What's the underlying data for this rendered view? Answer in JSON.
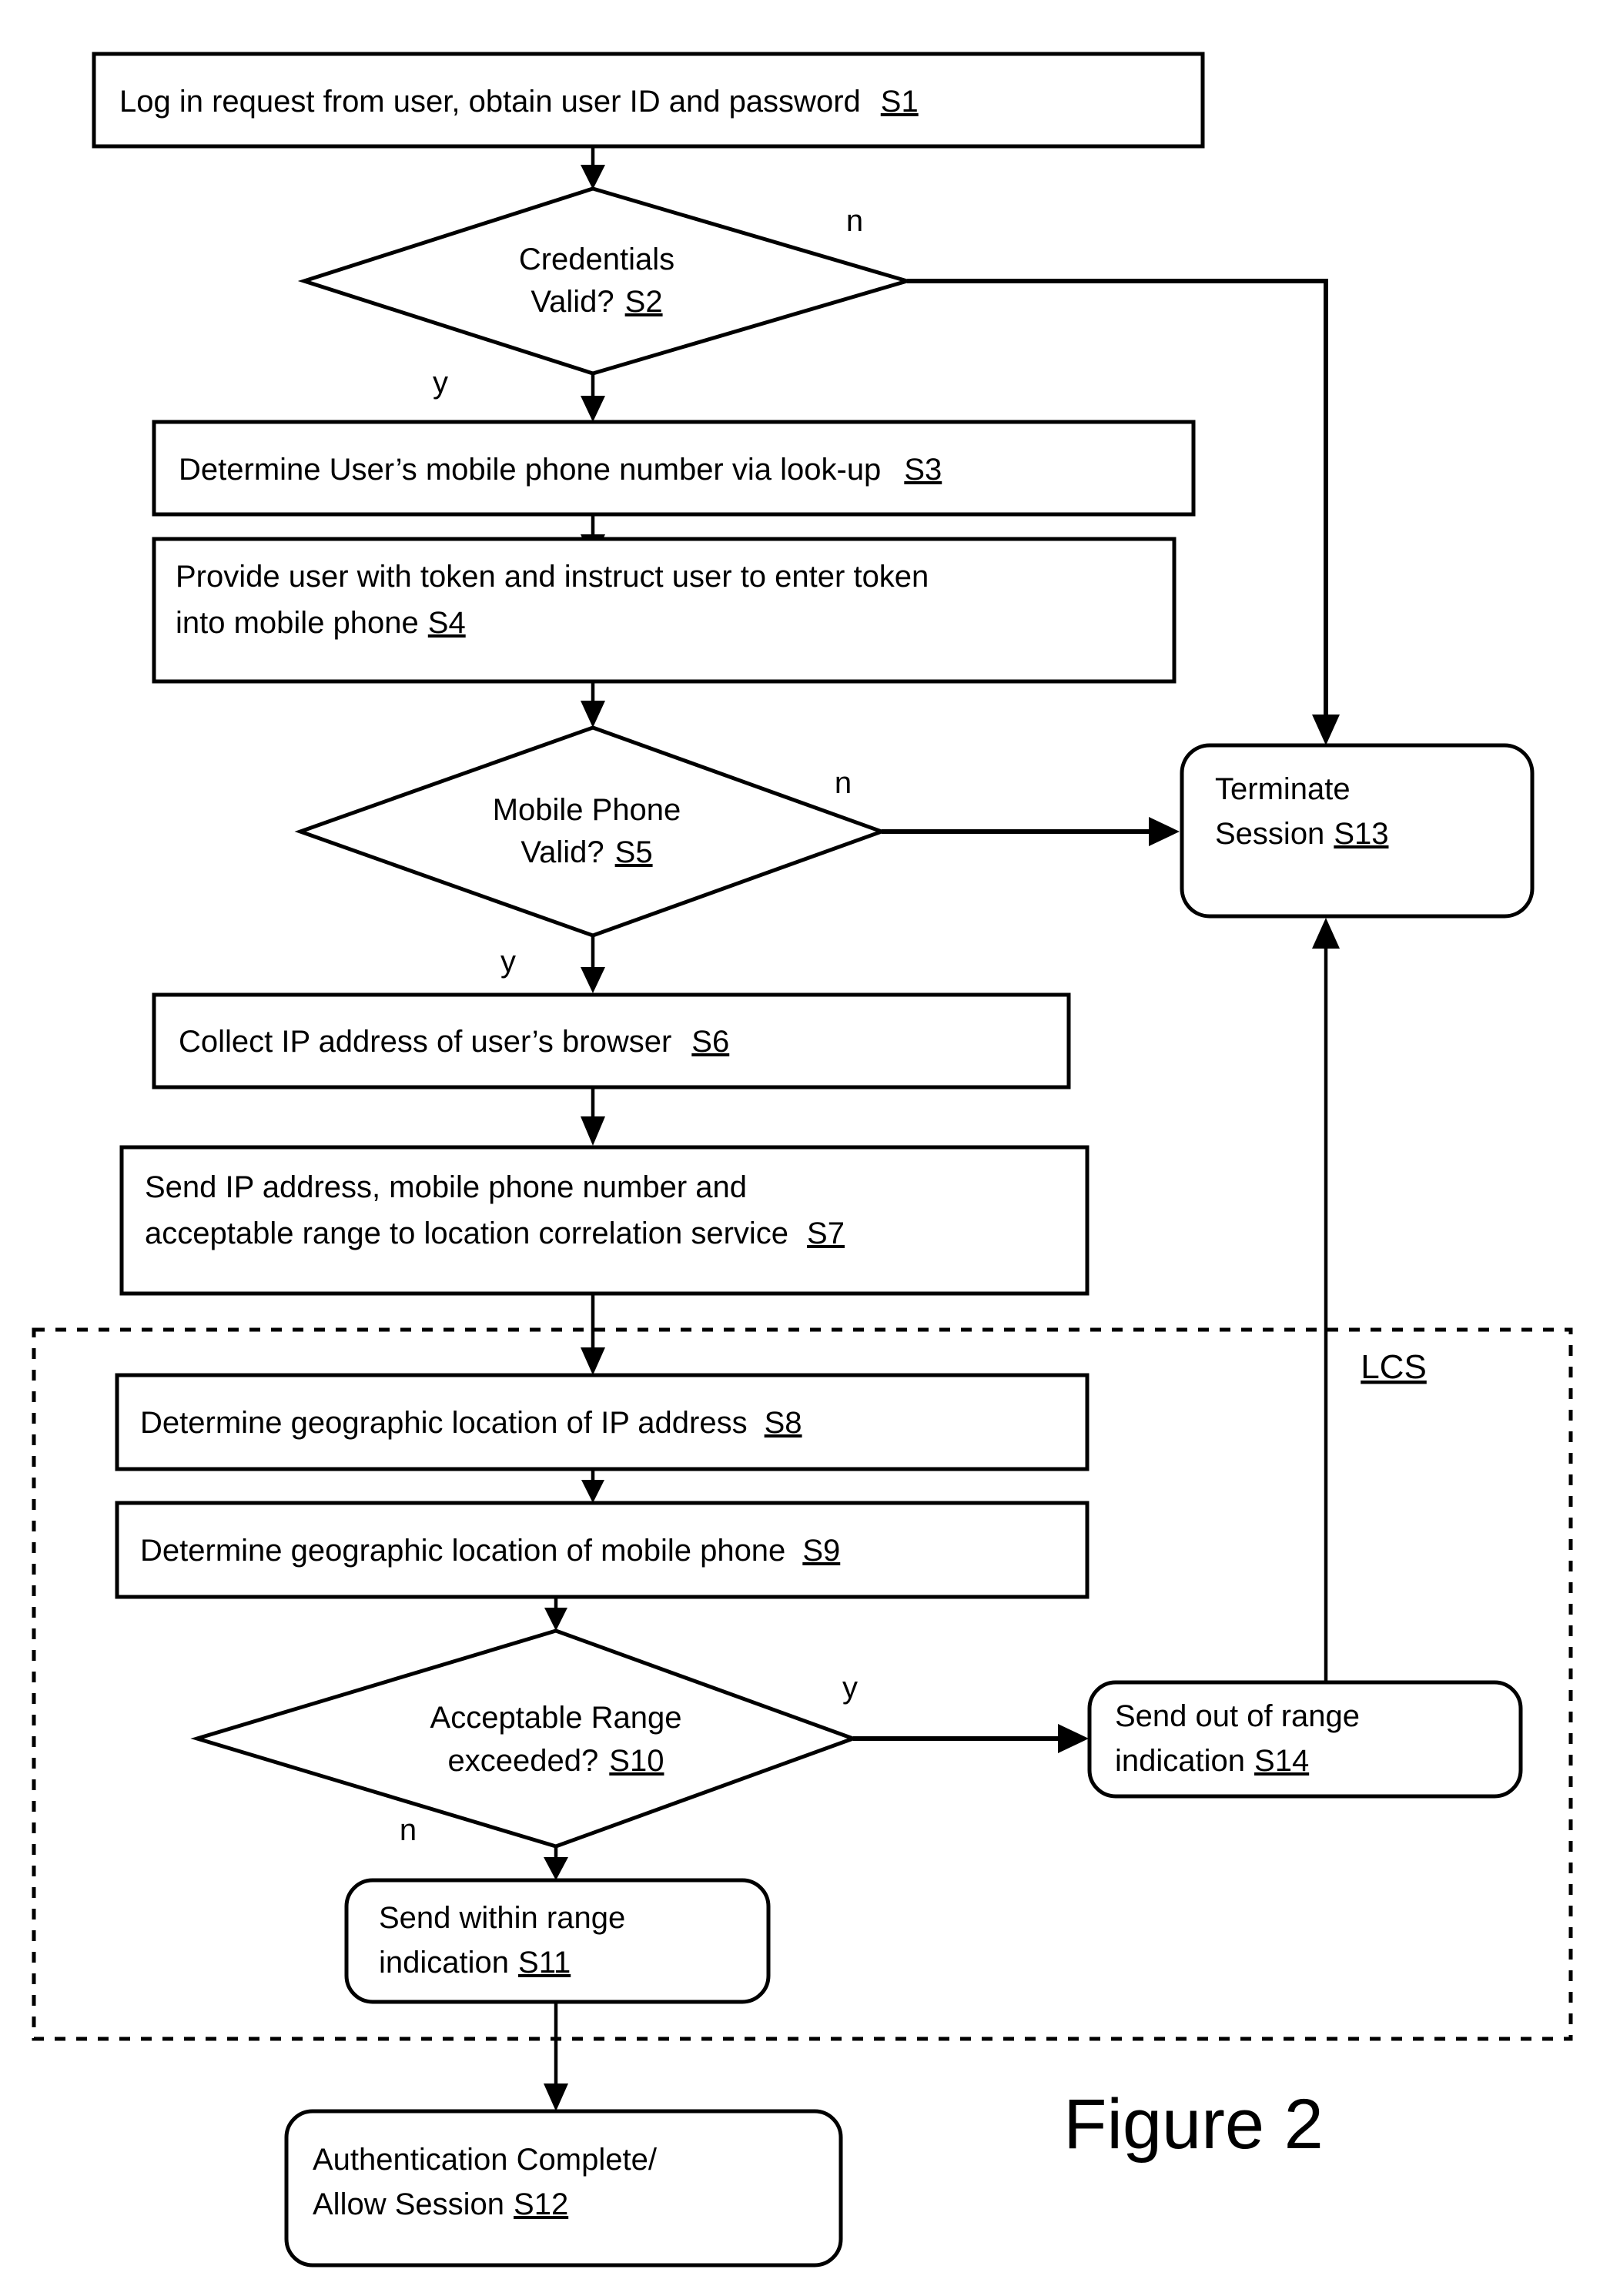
{
  "figure": {
    "caption": "Figure 2",
    "region_label": "LCS"
  },
  "branch_labels": {
    "s2_no": "n",
    "s2_yes": "y",
    "s5_no": "n",
    "s5_yes": "y",
    "s10_yes": "y",
    "s10_no": "n"
  },
  "nodes": {
    "s1": {
      "shape": "rect",
      "line1": "Log in request from user, obtain user ID and password",
      "step": "S1"
    },
    "s2": {
      "shape": "diamond",
      "line1": "Credentials",
      "line2": "Valid?",
      "step": "S2"
    },
    "s3": {
      "shape": "rect",
      "line1": "Determine User’s mobile phone number via look-up",
      "step": "S3"
    },
    "s4": {
      "shape": "rect",
      "line1": "Provide user with token and instruct user to enter token",
      "line2": "into mobile phone",
      "step": "S4"
    },
    "s5": {
      "shape": "diamond",
      "line1": "Mobile Phone",
      "line2": "Valid?",
      "step": "S5"
    },
    "s6": {
      "shape": "rect",
      "line1": "Collect IP address of user’s browser",
      "step": "S6"
    },
    "s7": {
      "shape": "rect",
      "line1": "Send IP address, mobile phone number and",
      "line2": "acceptable range to location correlation service",
      "step": "S7"
    },
    "s8": {
      "shape": "rect",
      "line1": "Determine geographic location of IP address",
      "step": "S8"
    },
    "s9": {
      "shape": "rect",
      "line1": "Determine geographic location of mobile phone",
      "step": "S9"
    },
    "s10": {
      "shape": "diamond",
      "line1": "Acceptable Range",
      "line2": "exceeded?",
      "step": "S10"
    },
    "s11": {
      "shape": "rounded-rect",
      "line1": "Send within range",
      "line2": "indication",
      "step": "S11"
    },
    "s12": {
      "shape": "rounded-rect",
      "line1": "Authentication Complete/",
      "line2": "Allow Session",
      "step": "S12"
    },
    "s13": {
      "shape": "rounded-rect",
      "line1": "Terminate",
      "line2": "Session",
      "step": "S13"
    },
    "s14": {
      "shape": "rounded-rect",
      "line1": "Send out of range",
      "line2": "indication",
      "step": "S14"
    }
  }
}
